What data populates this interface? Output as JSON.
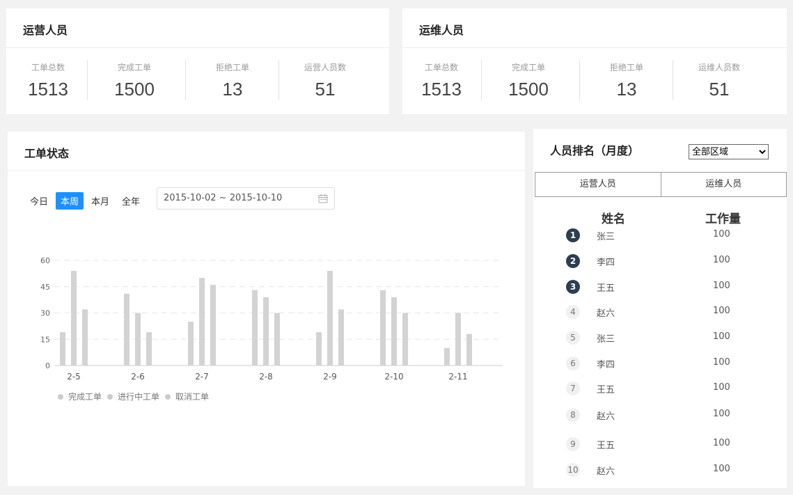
{
  "ops_card": {
    "title": "运营人员",
    "stats": [
      {
        "label": "工单总数",
        "value": "1513"
      },
      {
        "label": "完成工单",
        "value": "1500"
      },
      {
        "label": "拒绝工单",
        "value": "13"
      },
      {
        "label": "运营人员数",
        "value": "51"
      }
    ]
  },
  "maint_card": {
    "title": "运维人员",
    "stats": [
      {
        "label": "工单总数",
        "value": "1513"
      },
      {
        "label": "完成工单",
        "value": "1500"
      },
      {
        "label": "拒绝工单",
        "value": "13"
      },
      {
        "label": "运维人员数",
        "value": "51"
      }
    ]
  },
  "status_card": {
    "title": "工单状态",
    "filters": [
      "今日",
      "本周",
      "本月",
      "全年"
    ],
    "active_filter": "本周",
    "date_range": "2015-10-02 ~ 2015-10-10",
    "accent": "#1e90ff"
  },
  "chart_data": {
    "type": "bar",
    "categories": [
      "2-5",
      "2-6",
      "2-7",
      "2-8",
      "2-9",
      "2-10",
      "2-11"
    ],
    "series": [
      {
        "name": "完成工单",
        "values": [
          19,
          41,
          25,
          43,
          19,
          43,
          10
        ]
      },
      {
        "name": "进行中工单",
        "values": [
          54,
          30,
          50,
          39,
          54,
          39,
          30
        ]
      },
      {
        "name": "取消工单",
        "values": [
          32,
          19,
          46,
          30,
          32,
          30,
          18
        ]
      }
    ],
    "ylim": [
      0,
      60
    ],
    "yticks": [
      "0",
      "15",
      "30",
      "45",
      "60"
    ],
    "grid": true,
    "bar_color": "#d3d3d3",
    "legend_placement": "bottom-left"
  },
  "ranking": {
    "title": "人员排名（月度）",
    "region_select": "全部区域",
    "tabs": [
      "运营人员",
      "运维人员"
    ],
    "col_name": "姓名",
    "col_count": "工作量",
    "rows": [
      {
        "rank": "1",
        "name": "张三",
        "count": "100"
      },
      {
        "rank": "2",
        "name": "李四",
        "count": "100"
      },
      {
        "rank": "3",
        "name": "王五",
        "count": "100"
      },
      {
        "rank": "4",
        "name": "赵六",
        "count": "100"
      },
      {
        "rank": "5",
        "name": "张三",
        "count": "100"
      },
      {
        "rank": "6",
        "name": "李四",
        "count": "100"
      },
      {
        "rank": "7",
        "name": "王五",
        "count": "100"
      },
      {
        "rank": "8",
        "name": "赵六",
        "count": "100"
      },
      {
        "rank": "9",
        "name": "王五",
        "count": "100"
      },
      {
        "rank": "10",
        "name": "赵六",
        "count": "100"
      }
    ]
  }
}
